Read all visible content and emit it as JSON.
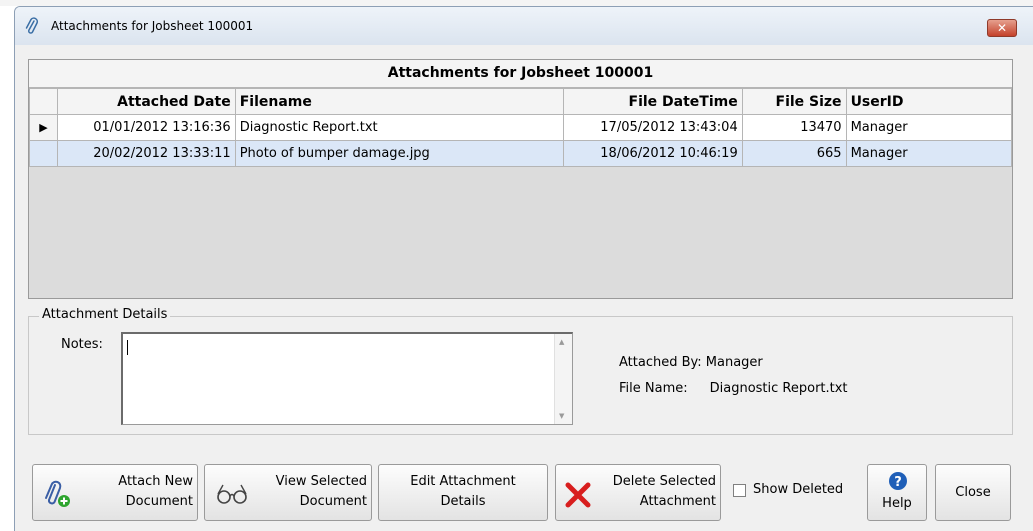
{
  "window": {
    "title": "Attachments for Jobsheet 100001",
    "close_glyph": "✕"
  },
  "grid": {
    "title": "Attachments for Jobsheet 100001",
    "columns": [
      "Attached Date",
      "Filename",
      "File DateTime",
      "File Size",
      "UserID"
    ],
    "rows": [
      {
        "attached_date": "01/01/2012 13:16:36",
        "filename": "Diagnostic Report.txt",
        "file_datetime": "17/05/2012 13:43:04",
        "file_size": "13470",
        "userid": "Manager",
        "current": true
      },
      {
        "attached_date": "20/02/2012 13:33:11",
        "filename": "Photo of bumper damage.jpg",
        "file_datetime": "18/06/2012 10:46:19",
        "file_size": "665",
        "userid": "Manager",
        "selected": true
      }
    ],
    "row_indicator": "▶"
  },
  "details": {
    "legend": "Attachment Details",
    "notes_label": "Notes:",
    "notes_value": "",
    "attached_by": "Attached By: Manager",
    "file_name_label": "File Name:",
    "file_name_value": "Diagnostic Report.txt"
  },
  "buttons": {
    "attach": {
      "line1": "Attach New",
      "line2": "Document",
      "icon": "paperclip-add-icon"
    },
    "view": {
      "line1": "View Selected",
      "line2": "Document",
      "icon": "glasses-icon"
    },
    "edit": {
      "line1": "Edit Attachment",
      "line2": "Details"
    },
    "delete": {
      "line1": "Delete Selected",
      "line2": "Attachment",
      "icon": "red-x-icon"
    },
    "help": {
      "label": "Help",
      "icon": "help-icon"
    },
    "close": {
      "label": "Close"
    }
  },
  "show_deleted": {
    "label": "Show Deleted",
    "checked": false
  },
  "colors": {
    "selected_row": "#dbe7f7",
    "delete_icon": "#d81e1e",
    "help_icon": "#1f5fb8",
    "add_icon": "#2ea52e"
  }
}
